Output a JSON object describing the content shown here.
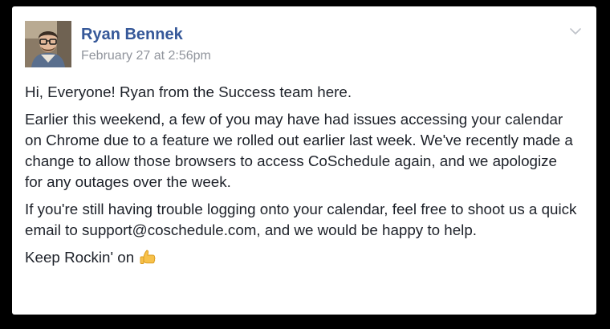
{
  "post": {
    "author": "Ryan Bennek",
    "timestamp": "February 27 at 2:56pm",
    "paragraphs": [
      "Hi, Everyone! Ryan from the Success team here.",
      "Earlier this weekend, a few of you may have had issues accessing your calendar on Chrome due to a feature we rolled out earlier last week. We've recently made a change to allow those browsers to access CoSchedule again, and we apologize for any outages over the week.",
      "If you're still having trouble logging onto your calendar, feel free to shoot us a quick email to support@coschedule.com, and we would be happy to help."
    ],
    "signoff": "Keep Rockin' on",
    "signoff_emoji": "thumbs-up-icon"
  },
  "colors": {
    "author": "#365899",
    "timestamp": "#90949c",
    "text": "#1d2129"
  }
}
